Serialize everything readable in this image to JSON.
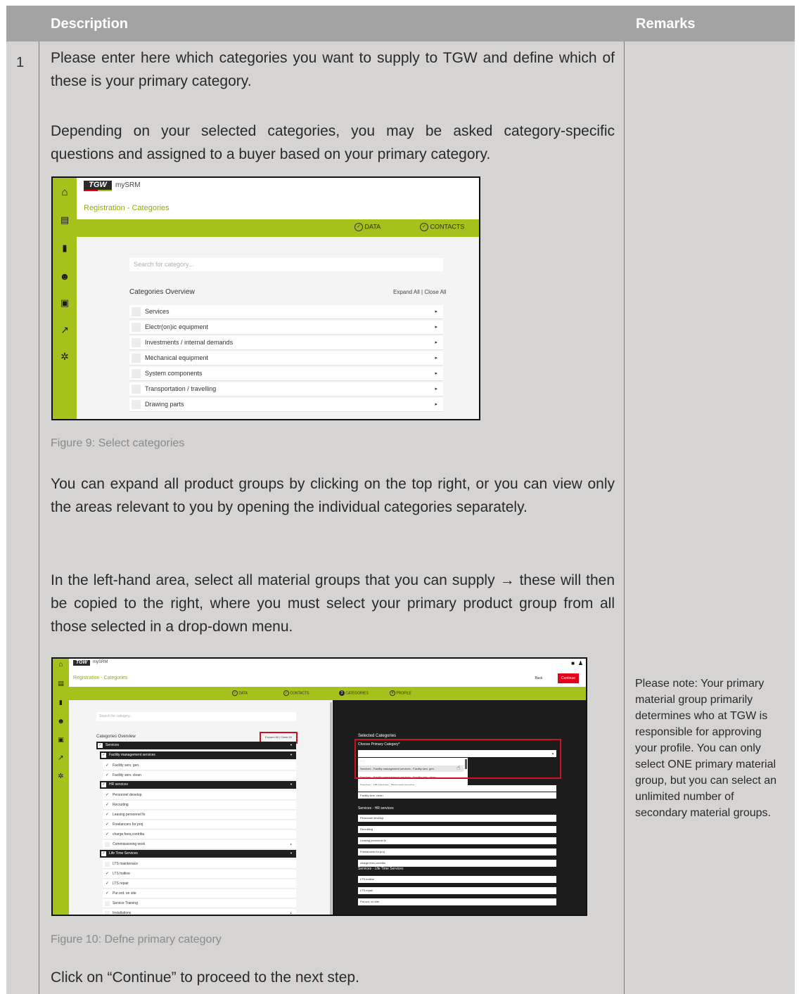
{
  "table": {
    "header_description": "Description",
    "header_remarks": "Remarks",
    "row_number": "1"
  },
  "paragraphs": {
    "p1": "Please enter here which categories you want to supply to TGW and define which of these is your primary category.",
    "p2": "Depending on your selected categories, you may be asked category-specific questions and assigned to a buyer based on your primary category.",
    "p3": "You can expand all product groups by clicking on the top right, or you can view only the areas relevant to you by opening the individual categories separately.",
    "p4": "In the left-hand area, select all material groups that you can supply → these will then be copied to the right, where you must select your primary product group from all those selected in a drop-down menu.",
    "p5": "Click on “Continue” to proceed to the next step."
  },
  "captions": {
    "fig9": "Figure 9: Select categories",
    "fig10": "Figure 10: Defne primary category"
  },
  "remark": "Please note: Your primary material group primarily determines who at TGW is responsible for approving your profile. You can only select ONE primary material group, but you can select an unlimited number of secondary material groups.",
  "screenshot1": {
    "logo": "TGW",
    "app_name": "mySRM",
    "page_title": "Registration - Categories",
    "steps": [
      "DATA",
      "CONTACTS"
    ],
    "search_placeholder": "Search for category...",
    "overview_title": "Categories Overview",
    "expand_close": "Expand All | Close All",
    "categories": [
      "Services",
      "Electr(on)ic equipment",
      "Investments / internal demands",
      "Mechanical equipment",
      "System components",
      "Transportation / travelling",
      "Drawing parts"
    ],
    "sidebar_icons": [
      "home-icon",
      "database-icon",
      "documents-icon",
      "hand-user-icon",
      "bus-icon",
      "hammer-icon",
      "gear-icon"
    ]
  },
  "screenshot2": {
    "logo": "TGW",
    "app_name": "mySRM",
    "page_title": "Registration - Categories",
    "back_label": "Back",
    "continue_label": "Continue",
    "steps": [
      "DATA",
      "CONTACTS",
      "CATEGORIES",
      "PROFILE"
    ],
    "search_placeholder": "Search for category...",
    "overview_title": "Categories Overview",
    "expand_close": "Expand All | Close All",
    "left_rows": [
      {
        "type": "dark",
        "label": "Services"
      },
      {
        "type": "dark",
        "label": "Facility management services"
      },
      {
        "type": "item",
        "label": "Facility serv. gen.",
        "checked": true
      },
      {
        "type": "item",
        "label": "Facility serv. clean",
        "checked": true
      },
      {
        "type": "dark",
        "label": "HR services"
      },
      {
        "type": "item",
        "label": "Personnel develop.",
        "checked": true
      },
      {
        "type": "item",
        "label": "Recruiting",
        "checked": true
      },
      {
        "type": "item",
        "label": "Leasing personnel fo",
        "checked": true
      },
      {
        "type": "item",
        "label": "Freelancers for proj",
        "checked": true
      },
      {
        "type": "item",
        "label": "charge,fees,contribu",
        "checked": true
      },
      {
        "type": "item",
        "label": "Commissioning work",
        "checked": false
      },
      {
        "type": "dark",
        "label": "Life Time Services"
      },
      {
        "type": "item",
        "label": "LTS maintenace",
        "checked": false
      },
      {
        "type": "item",
        "label": "LTS hotline",
        "checked": true
      },
      {
        "type": "item",
        "label": "LTS repair",
        "checked": true
      },
      {
        "type": "item",
        "label": "Pur.ord. on site",
        "checked": true
      },
      {
        "type": "item",
        "label": "Service Training",
        "checked": false
      },
      {
        "type": "item",
        "label": "Installations",
        "checked": false
      }
    ],
    "selected_title": "Selected Categories",
    "primary_label": "Choose Primary Category*",
    "dropdown_blank": "- - -",
    "dropdown_options": [
      "Services - Facility management services - Facility serv. gen.",
      "Services - Facility management services - Facility serv. clean",
      "Services - HR services - Personnel develop."
    ],
    "facility_clean": "Facility serv. clean",
    "hr_group": "Services - HR services",
    "hr_items": [
      "Personnel develop.",
      "Recruiting",
      "Leasing personnel fo",
      "Freelancers for proj",
      "charge,fees,contribu"
    ],
    "lts_group": "Services - Life Time Services",
    "lts_items": [
      "LTS hotline",
      "LTS repair",
      "Pur.ord. on site"
    ]
  },
  "colors": {
    "brand_green": "#a5c11b",
    "highlight_red": "#d0101a",
    "header_gray": "#a3a3a3",
    "cell_gray": "#d5d4d2"
  }
}
